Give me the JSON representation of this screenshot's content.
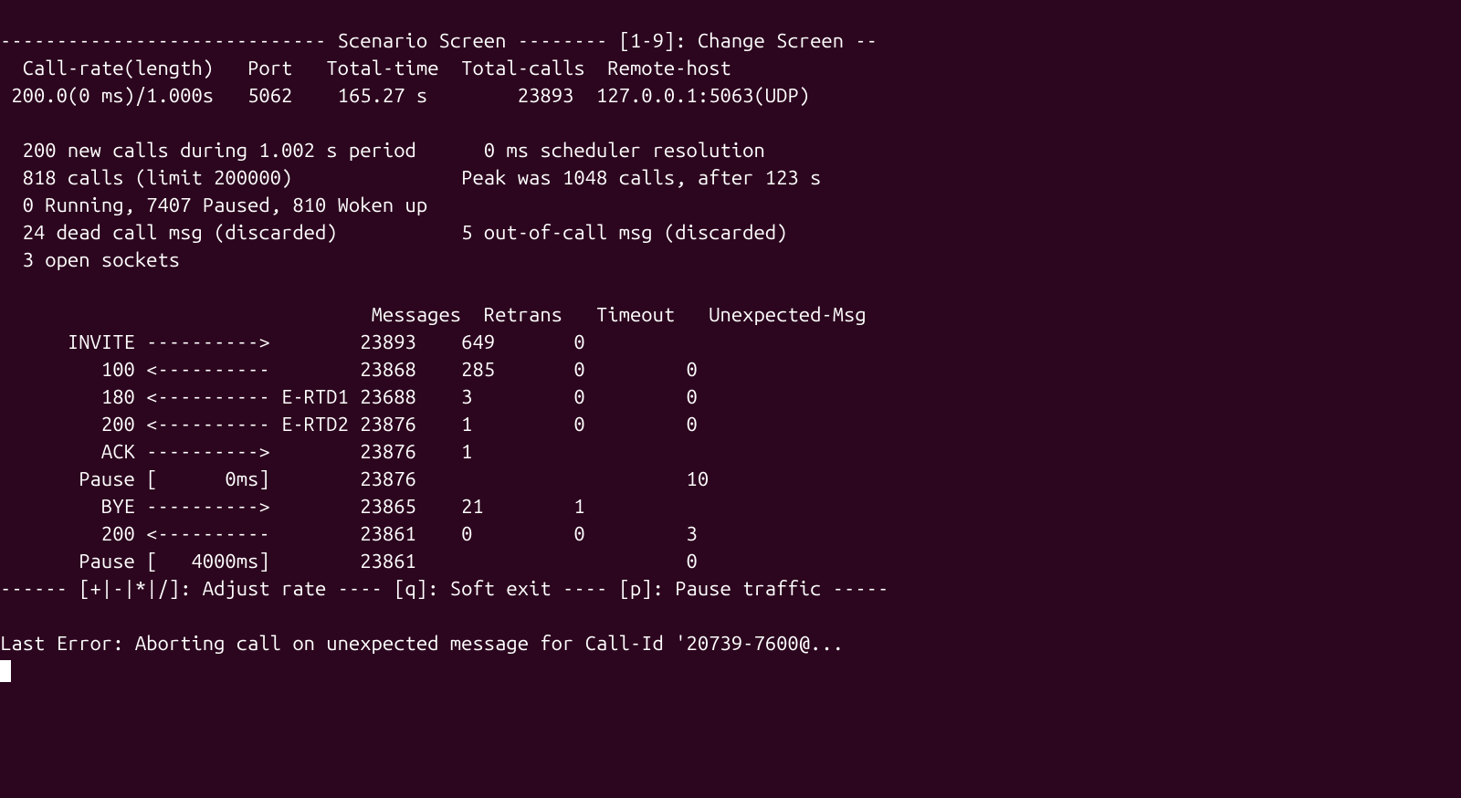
{
  "header": {
    "title": "Scenario Screen",
    "nav_hint": "[1-9]: Change Screen"
  },
  "summary": {
    "headers": {
      "call_rate": "Call-rate(length)",
      "port": "Port",
      "total_time": "Total-time",
      "total_calls": "Total-calls",
      "remote_host": "Remote-host"
    },
    "values": {
      "call_rate": "200.0(0 ms)/1.000s",
      "port": "5062",
      "total_time": "165.27 s",
      "total_calls": "23893",
      "remote_host": "127.0.0.1:5063(UDP)"
    }
  },
  "stats": {
    "new_calls": "200 new calls during 1.002 s period",
    "scheduler": "0 ms scheduler resolution",
    "calls_limit": "818 calls (limit 200000)",
    "peak": "Peak was 1048 calls, after 123 s",
    "running": "0 Running, 7407 Paused, 810 Woken up",
    "dead_call": "24 dead call msg (discarded)",
    "out_of_call": "5 out-of-call msg (discarded)",
    "sockets": "3 open sockets"
  },
  "table": {
    "headers": {
      "messages": "Messages",
      "retrans": "Retrans",
      "timeout": "Timeout",
      "unexpected": "Unexpected-Msg"
    },
    "rows": [
      {
        "label": "INVITE",
        "arrow": "---------->",
        "tag": "",
        "messages": "23893",
        "retrans": "649",
        "timeout": "0",
        "unexpected": ""
      },
      {
        "label": "100",
        "arrow": "<----------",
        "tag": "",
        "messages": "23868",
        "retrans": "285",
        "timeout": "0",
        "unexpected": "0"
      },
      {
        "label": "180",
        "arrow": "<----------",
        "tag": "E-RTD1",
        "messages": "23688",
        "retrans": "3",
        "timeout": "0",
        "unexpected": "0"
      },
      {
        "label": "200",
        "arrow": "<----------",
        "tag": "E-RTD2",
        "messages": "23876",
        "retrans": "1",
        "timeout": "0",
        "unexpected": "0"
      },
      {
        "label": "ACK",
        "arrow": "---------->",
        "tag": "",
        "messages": "23876",
        "retrans": "1",
        "timeout": "",
        "unexpected": ""
      },
      {
        "label": "Pause",
        "arrow": "[      0ms]",
        "tag": "",
        "messages": "23876",
        "retrans": "",
        "timeout": "",
        "unexpected": "10"
      },
      {
        "label": "BYE",
        "arrow": "---------->",
        "tag": "",
        "messages": "23865",
        "retrans": "21",
        "timeout": "1",
        "unexpected": ""
      },
      {
        "label": "200",
        "arrow": "<----------",
        "tag": "",
        "messages": "23861",
        "retrans": "0",
        "timeout": "0",
        "unexpected": "3"
      }
    ],
    "final_pause": {
      "label": "Pause",
      "arrow": "[   4000ms]",
      "tag": "",
      "messages": "23861",
      "retrans": "",
      "timeout": "",
      "unexpected": "0"
    }
  },
  "footer": {
    "controls": "------ [+|-|*|/]: Adjust rate ---- [q]: Soft exit ---- [p]: Pause traffic -----",
    "last_error": "Last Error: Aborting call on unexpected message for Call-Id '20739-7600@..."
  }
}
